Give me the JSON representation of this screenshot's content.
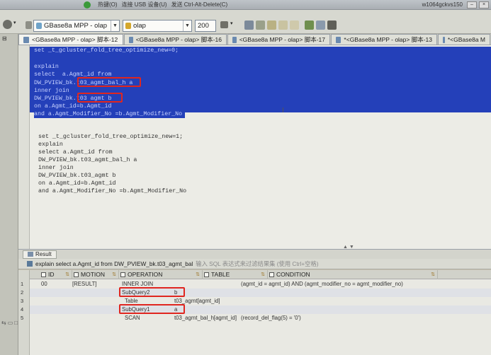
{
  "vm_bar": {
    "items": [
      "热键(O)",
      "连接 USB 设备(U)",
      "发送 Ctrl-Alt-Delete(C)"
    ],
    "host": "w1064gckvs150"
  },
  "toolbar": {
    "connection": "GBase8a MPP - olap",
    "database": "olap",
    "limit": "200"
  },
  "tabs": [
    {
      "label": "<GBase8a MPP - olap> 脚本-12",
      "active": true
    },
    {
      "label": "<GBase8a MPP - olap> 脚本-16",
      "active": false
    },
    {
      "label": "<GBase8a MPP - olap> 脚本-17",
      "active": false
    },
    {
      "label": "*<GBase8a MPP - olap> 脚本-13",
      "active": false
    },
    {
      "label": "*<GBase8a M",
      "active": false
    }
  ],
  "editor": {
    "selected_lines": [
      "set _t_gcluster_fold_tree_optimize_new=0;",
      "",
      "explain",
      "select  a.Agmt_id from",
      "DW_PVIEW_bk.t03_agmt_bal_h a",
      "inner join",
      "DW_PVIEW_bk.t03 agmt b",
      "on a.Agmt_id=b.Agmt_id",
      "and a.Agmt_Modifier_No =b.Agmt_Modifier_No"
    ],
    "plain_lines": [
      "set _t_gcluster_fold_tree_optimize_new=1;",
      "explain",
      "select a.Agmt_id from",
      "DW_PVIEW_bk.t03_agmt_bal_h a",
      "inner join",
      "DW_PVIEW_bk.t03_agmt b",
      "on a.Agmt_id=b.Agmt_id",
      "and a.Agmt_Modifier_No =b.Agmt_Modifier_No"
    ]
  },
  "result": {
    "tab_label": "Result",
    "query": "explain select a.Agmt_id from DW_PVIEW_bk.t03_agmt_bal",
    "filter_hint": "输入 SQL 表达式来过滤结果集 (使用 Ctrl+空格)",
    "columns": [
      "ID",
      "MOTION",
      "OPERATION",
      "TABLE",
      "CONDITION"
    ],
    "rows": [
      {
        "num": "1",
        "id": "00",
        "motion": "[RESULT]",
        "operation": "INNER JOIN",
        "table": "",
        "condition": "(agmt_id = agmt_id) AND (agmt_modifier_no = agmt_modifier_no)"
      },
      {
        "num": "2",
        "id": "",
        "motion": "",
        "operation": "SubQuery2",
        "table": "b",
        "condition": ""
      },
      {
        "num": "3",
        "id": "",
        "motion": "",
        "operation": "Table",
        "table": "t03_agmt[agmt_id]",
        "condition": ""
      },
      {
        "num": "4",
        "id": "",
        "motion": "",
        "operation": "SubQuery1",
        "table": "a",
        "condition": ""
      },
      {
        "num": "5",
        "id": "",
        "motion": "",
        "operation": "SCAN",
        "table": "t03_agmt_bal_h[agmt_id]",
        "condition": "(record_del_flag(5) = '0')"
      }
    ]
  },
  "colors": {
    "selection": "#2440b9",
    "highlight_box": "#e0261f"
  }
}
